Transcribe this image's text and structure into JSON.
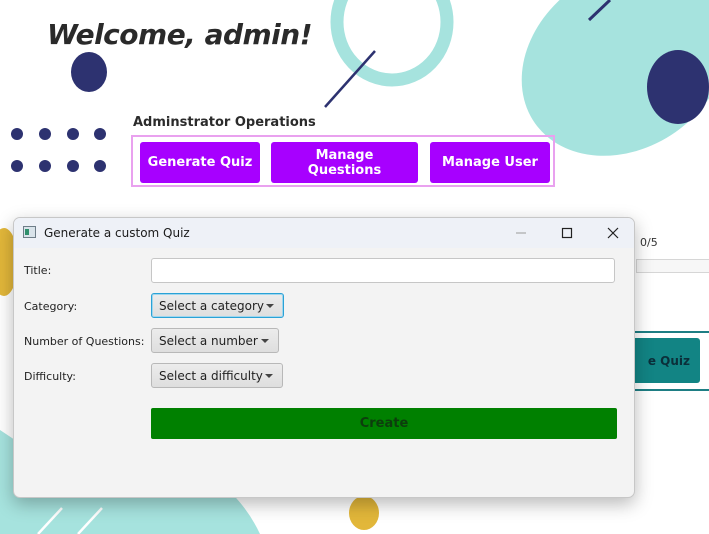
{
  "main": {
    "welcome": "Welcome, admin!",
    "operations_label": "Adminstrator Operations",
    "buttons": {
      "generate_quiz": "Generate Quiz",
      "manage_questions": "Manage Questions",
      "manage_user": "Manage User"
    },
    "progress_text": "0/5",
    "quiz_button_partial": "e Quiz"
  },
  "dialog": {
    "title": "Generate a custom Quiz",
    "icons": [
      "app-icon",
      "minimize-icon",
      "maximize-icon",
      "close-icon"
    ],
    "fields": {
      "title_label": "Title:",
      "title_value": "",
      "category_label": "Category:",
      "category_value": "Select a category",
      "number_label": "Number of Questions:",
      "number_value": "Select a number",
      "difficulty_label": "Difficulty:",
      "difficulty_value": "Select a difficulty"
    },
    "create_label": "Create"
  },
  "colors": {
    "accent_purple": "#a700ff",
    "teal": "#a6e3de",
    "navy": "#2d3270",
    "create_green": "#008000",
    "quiz_teal": "#128484",
    "mustard": "#e2b73a"
  }
}
